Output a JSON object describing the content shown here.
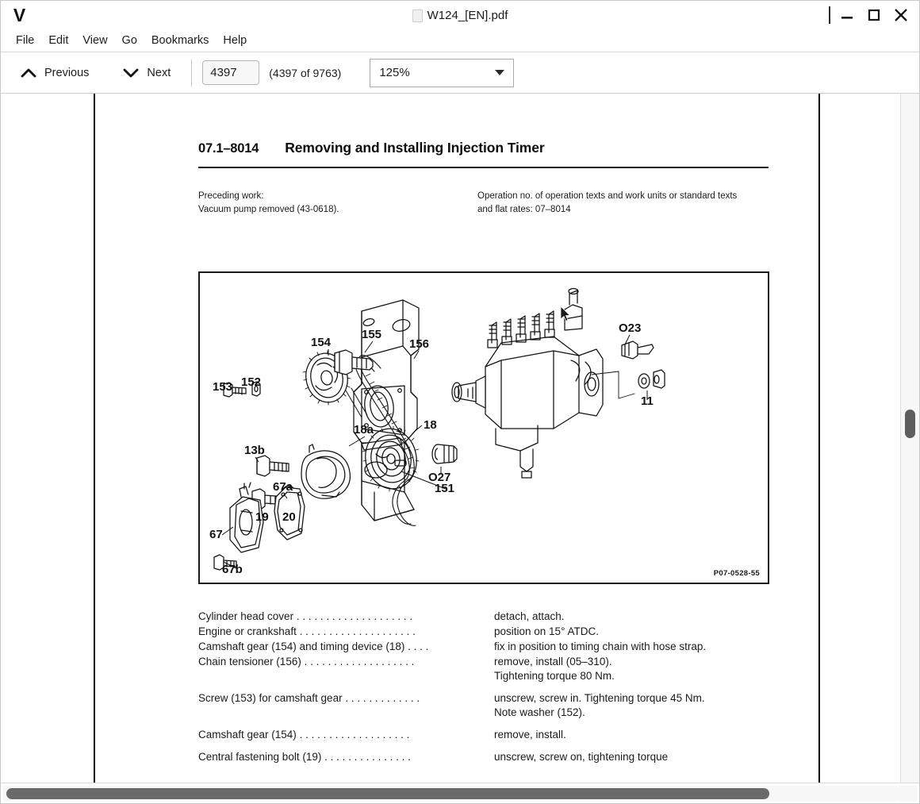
{
  "window": {
    "app_logo": "V",
    "title": "W124_[EN].pdf",
    "doc_icon": "document-icon",
    "controls": {
      "minimize": "—",
      "maximize": "□",
      "close": "✕"
    }
  },
  "menubar": {
    "items": [
      {
        "label": "File"
      },
      {
        "label": "Edit"
      },
      {
        "label": "View"
      },
      {
        "label": "Go"
      },
      {
        "label": "Bookmarks"
      },
      {
        "label": "Help"
      }
    ]
  },
  "toolbar": {
    "previous_label": "Previous",
    "previous_icon": "chevron-up-icon",
    "next_label": "Next",
    "next_icon": "chevron-down-icon",
    "page_input_value": "4397",
    "page_count_label": "(4397 of 9763)",
    "zoom_value": "125%",
    "zoom_caret_icon": "chevron-down-icon"
  },
  "document": {
    "section_code": "07.1–8014",
    "section_title": "Removing and Installing Injection Timer",
    "preceding_work_label": "Preceding work:",
    "preceding_work_value": "Vacuum pump removed (43-0618).",
    "operation_note_line1": "Operation no. of operation texts and work units or standard texts",
    "operation_note_line2": "and flat rates: 07–8014",
    "figure": {
      "code": "P07-0528-55",
      "callouts": [
        "153",
        "152",
        "154",
        "155",
        "156",
        "18",
        "18a",
        "13b",
        "67",
        "67a",
        "67b",
        "19",
        "20",
        "151",
        "O27",
        "O23",
        "11"
      ]
    },
    "instructions": [
      {
        "part": "Cylinder head cover",
        "leader": ". . . . . . . . . . . . . . . . . . . .",
        "action": "detach, attach.",
        "action_sub": ""
      },
      {
        "part": "Engine or crankshaft",
        "leader": ". . . . . . . . . . . . . . . . . . . .",
        "action": "position on 15° ATDC.",
        "action_sub": ""
      },
      {
        "part": "Camshaft gear (154) and timing device (18)",
        "leader": ". . . .",
        "action": "fix in position to timing chain with hose strap.",
        "action_sub": ""
      },
      {
        "part": "Chain tensioner (156)",
        "leader": ". . . . . . . . . . . . . . . . . . .",
        "action": "remove, install (05–310).",
        "action_sub": "Tightening torque 80 Nm."
      },
      {
        "part": "Screw (153) for camshaft gear",
        "leader": ". . . . . . . . . . . . .",
        "action": "unscrew, screw in. Tightening torque 45 Nm.",
        "action_sub": "Note washer (152)."
      },
      {
        "part": "Camshaft gear (154)",
        "leader": ". . . . . . . . . . . . . . . . . . .",
        "action": "remove, install.",
        "action_sub": ""
      },
      {
        "part": "Central fastening bolt (19)",
        "leader": ". . . . . . . . . . . . . . .",
        "action": "unscrew, screw on, tightening torque",
        "action_sub": ""
      }
    ]
  },
  "scrollbars": {
    "vertical_name": "vertical-scrollbar",
    "horizontal_name": "horizontal-scrollbar"
  }
}
